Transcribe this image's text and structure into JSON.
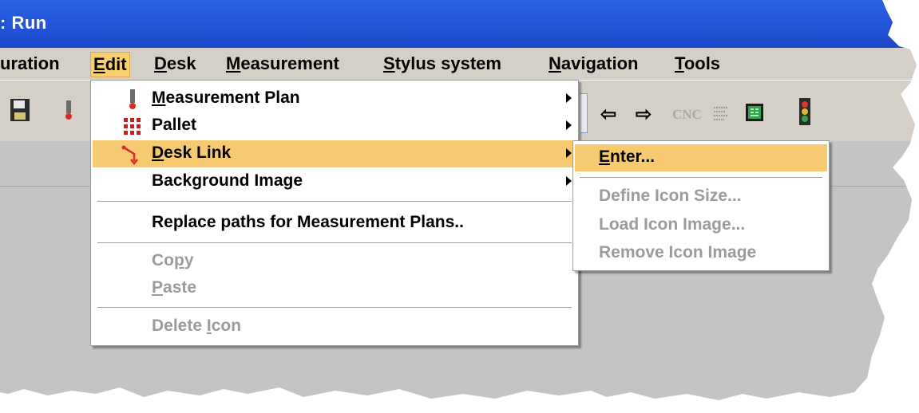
{
  "window": {
    "title": ": Run"
  },
  "menubar": {
    "items": [
      {
        "label": "uration",
        "mn": ""
      },
      {
        "label": "Edit",
        "mn": "E",
        "rest": "dit"
      },
      {
        "label": "Desk",
        "mn": "D",
        "rest": "esk"
      },
      {
        "label": "Measurement",
        "mn": "M",
        "rest": "easurement"
      },
      {
        "label": "Stylus system",
        "mn": "S",
        "rest": "tylus system"
      },
      {
        "label": "Navigation",
        "mn": "N",
        "rest": "avigation"
      },
      {
        "label": "Tools",
        "mn": "T",
        "rest": "ools"
      }
    ],
    "active": "Edit"
  },
  "toolbar": {
    "left_arrow": "⇦",
    "right_arrow": "⇨",
    "cnc_label": "CNC"
  },
  "edit_menu": {
    "items": [
      {
        "mn": "M",
        "rest": "easurement Plan",
        "icon": "stylus-icon",
        "submenu": true,
        "enabled": true
      },
      {
        "mn": "",
        "rest": "Pallet",
        "icon": "pallet-grid-icon",
        "submenu": true,
        "enabled": true
      },
      {
        "mn": "D",
        "rest": "esk Link",
        "icon": "desk-link-icon",
        "submenu": true,
        "enabled": true,
        "highlighted": true
      },
      {
        "mn": "",
        "rest": "Background Image",
        "icon": "",
        "submenu": true,
        "enabled": true
      },
      {
        "mn": "",
        "rest": "Replace paths for Measurement Plans..",
        "icon": "",
        "submenu": false,
        "enabled": true
      },
      {
        "pre": "Co",
        "mn": "p",
        "rest": "y",
        "enabled": false
      },
      {
        "mn": "P",
        "rest": "aste",
        "enabled": false
      },
      {
        "pre": "Delete ",
        "mn": "I",
        "rest": "con",
        "enabled": false
      }
    ]
  },
  "desk_link_submenu": {
    "items": [
      {
        "mn": "E",
        "rest": "nter...",
        "enabled": true,
        "highlighted": true
      },
      {
        "label": "Define Icon Size...",
        "enabled": false
      },
      {
        "label": "Load Icon Image...",
        "enabled": false
      },
      {
        "label": "Remove Icon Image",
        "enabled": false
      }
    ]
  },
  "colors": {
    "titlebar": "#1f52d6",
    "menu_highlight": "#f7ca71",
    "disabled_text": "#9b9b9b",
    "menu_bg": "#ffffff",
    "window_bg": "#c4c4c4"
  }
}
